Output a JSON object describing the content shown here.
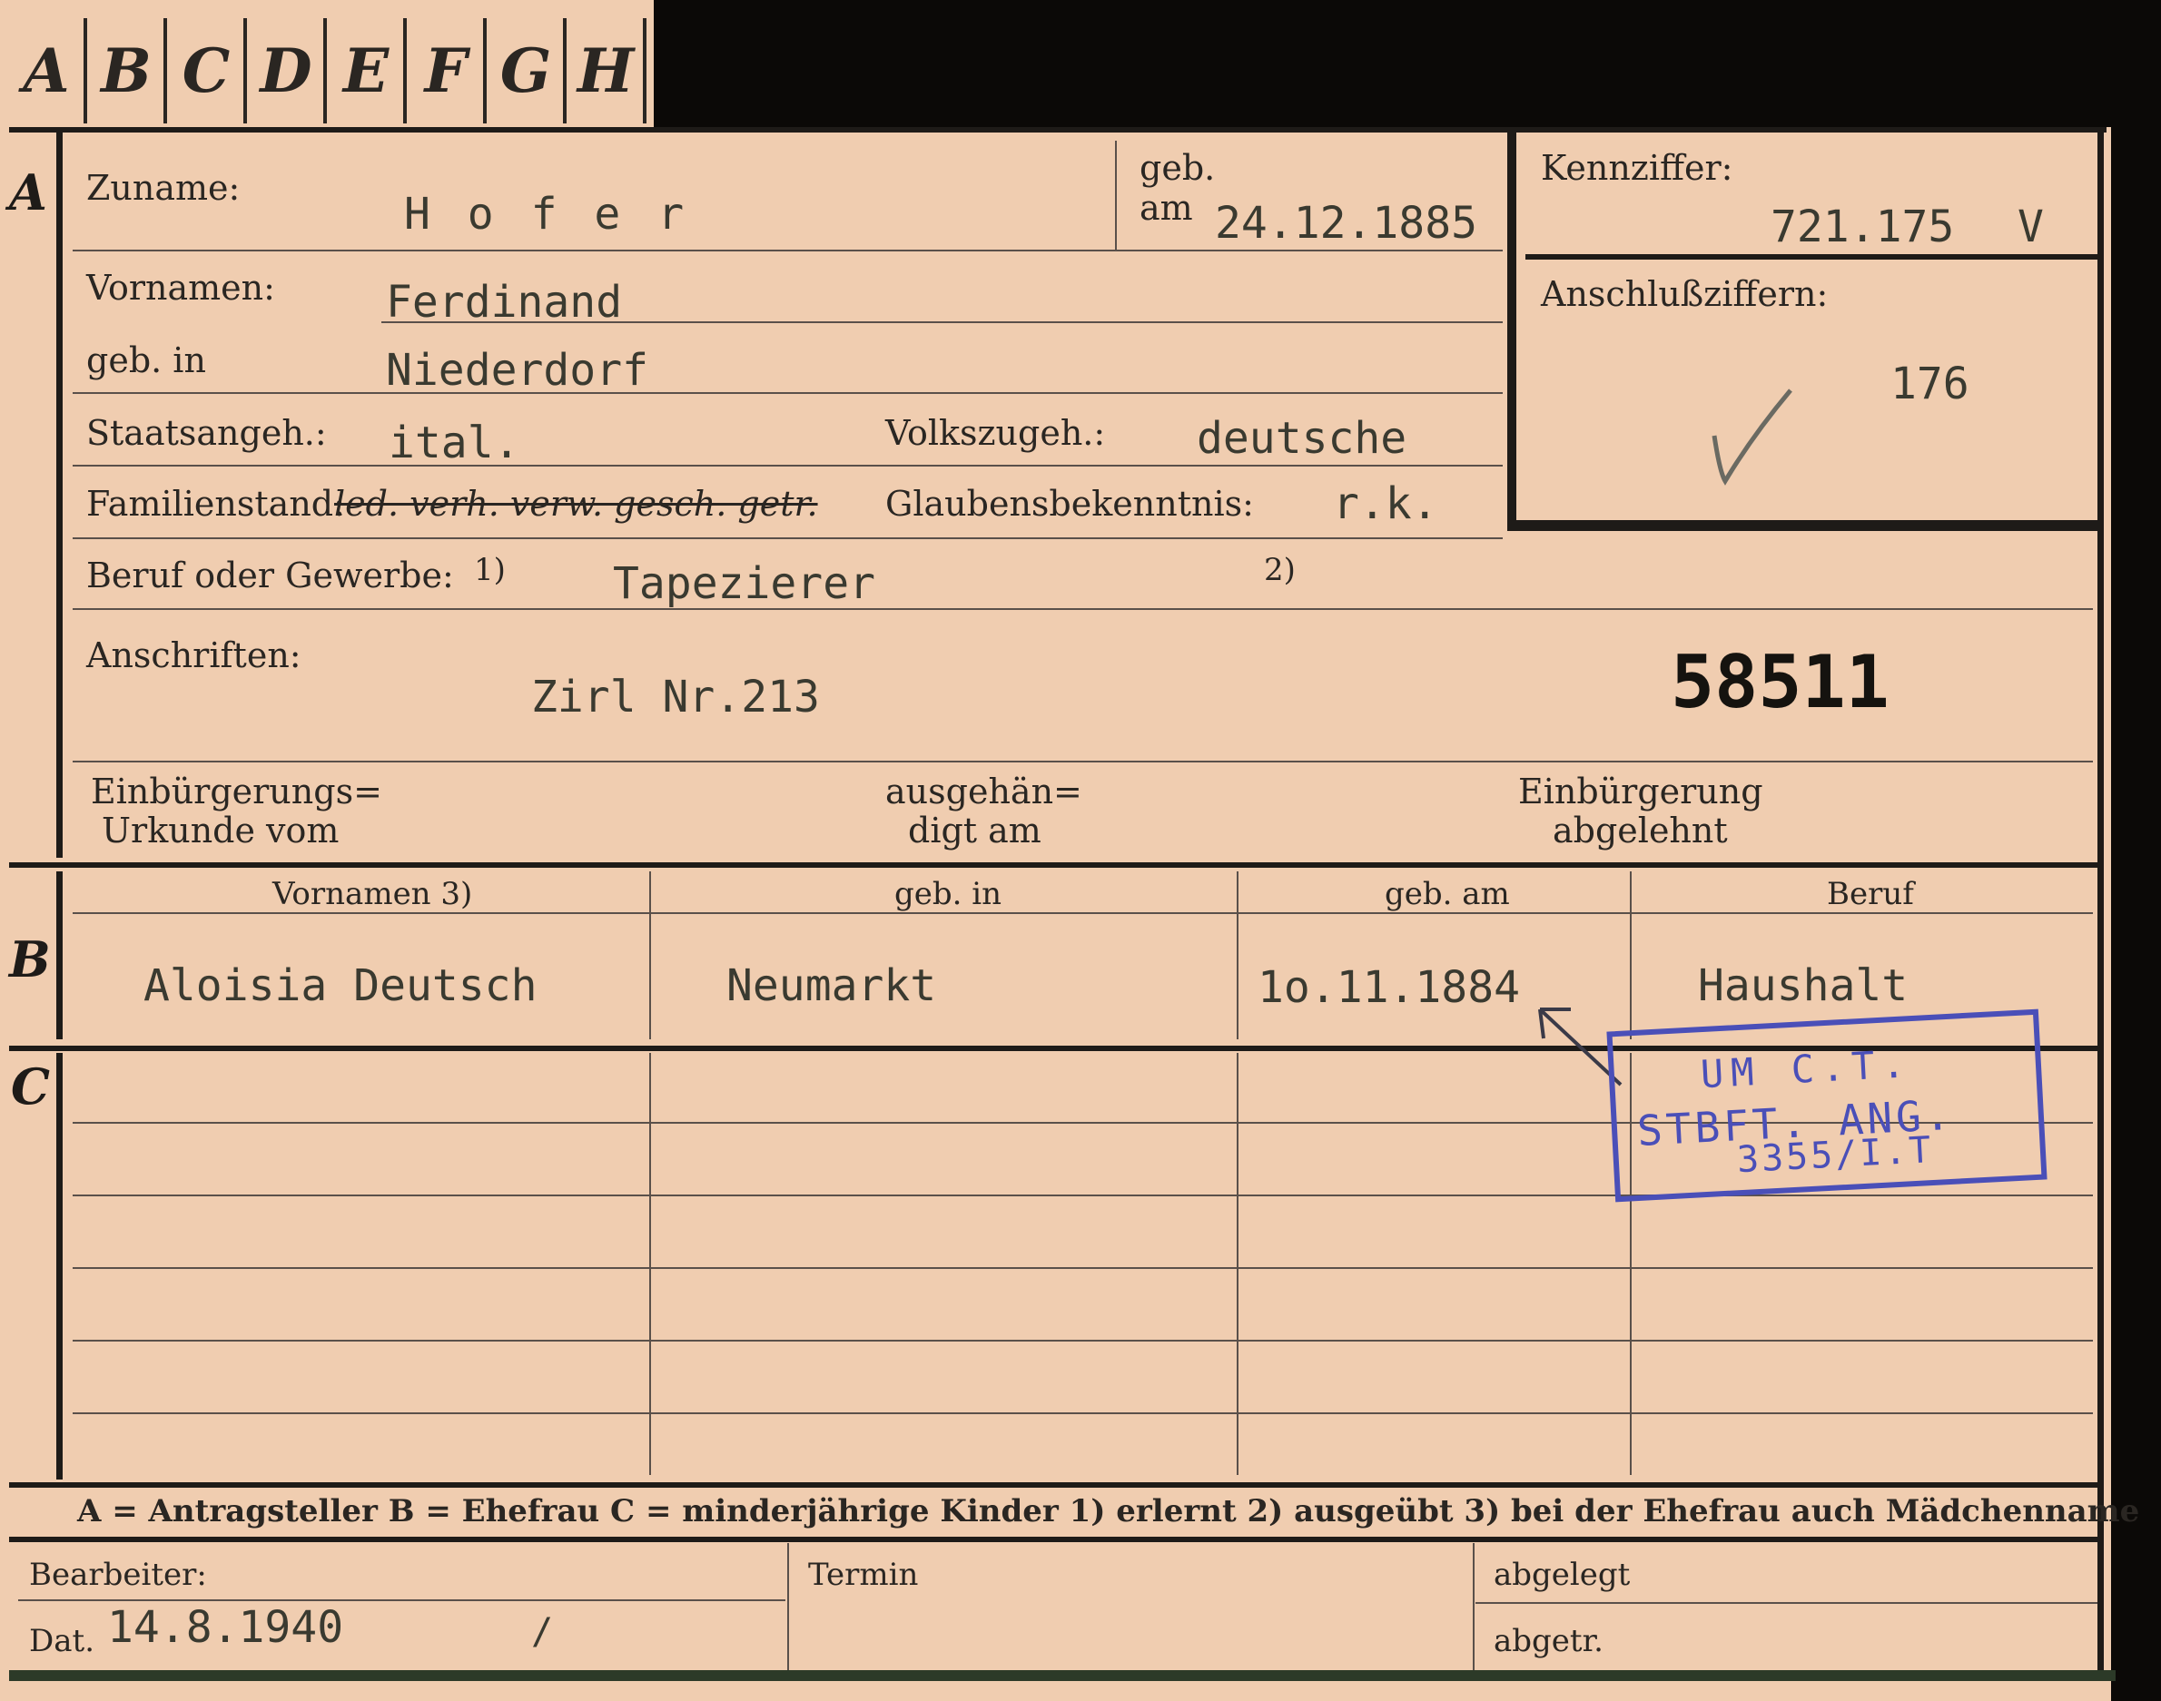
{
  "tabs": [
    "A",
    "B",
    "C",
    "D",
    "E",
    "F",
    "G",
    "H"
  ],
  "section_letters": {
    "a": "A",
    "b": "B",
    "c": "C"
  },
  "labels": {
    "zuname": "Zuname:",
    "geb": "geb.",
    "am": "am",
    "kennziffer": "Kennziffer:",
    "vornamen": "Vornamen:",
    "geb_in": "geb. in",
    "anschlussziffern": "Anschlußziffern:",
    "staatsangeh": "Staatsangeh.:",
    "volkszugeh": "Volkszugeh.:",
    "familienstand": "Familienstand:",
    "familienstand_options": "led. verh. verw. gesch. getr.",
    "glaubensbekenntnis": "Glaubensbekenntnis:",
    "beruf": "Beruf oder Gewerbe:",
    "fn1": "1)",
    "fn2": "2)",
    "anschriften": "Anschriften:",
    "einbuergerungs_1": "Einbürgerungs=",
    "einbuergerungs_2": "Urkunde vom",
    "ausgehaen_1": "ausgehän=",
    "ausgehaen_2": "digt am",
    "abgelehnt_1": "Einbürgerung",
    "abgelehnt_2": "abgelehnt"
  },
  "person": {
    "zuname": "H o f e r",
    "geb_am": "24.12.1885",
    "kennziffer": "721.175",
    "kennziffer_suffix": "V",
    "vornamen": "Ferdinand",
    "geb_in": "Niederdorf",
    "anschlussziffer": "176",
    "staatsangeh": "ital.",
    "volkszugeh": "deutsche",
    "glaubensbekenntnis": "r.k.",
    "beruf": "Tapezierer",
    "anschrift": "Zirl Nr.213",
    "file_number": "58511"
  },
  "spouse_table": {
    "headers": [
      "Vornamen 3)",
      "geb. in",
      "geb. am",
      "Beruf"
    ],
    "row": [
      "Aloisia Deutsch",
      "Neumarkt",
      "1o.11.1884",
      "Haushalt"
    ]
  },
  "legend": "A = Antragsteller  B = Ehefrau  C = minderjährige Kinder  1) erlernt  2) ausgeübt  3) bei der Ehefrau auch Mädchenname",
  "footer": {
    "bearbeiter": "Bearbeiter:",
    "dat": "Dat.",
    "dat_value": "14.8.1940",
    "slash": "/",
    "termin": "Termin",
    "abgelegt": "abgelegt",
    "abgetr": "abgetr."
  },
  "stamp": {
    "line1": "UM C.T.",
    "line2": "STBFT. ANG.",
    "line3": "3355/I.T"
  },
  "colors": {
    "paper": "#f0cdb0",
    "ink": "#2a2622",
    "stamp": "#4a4fb8",
    "background": "#0b0907"
  }
}
